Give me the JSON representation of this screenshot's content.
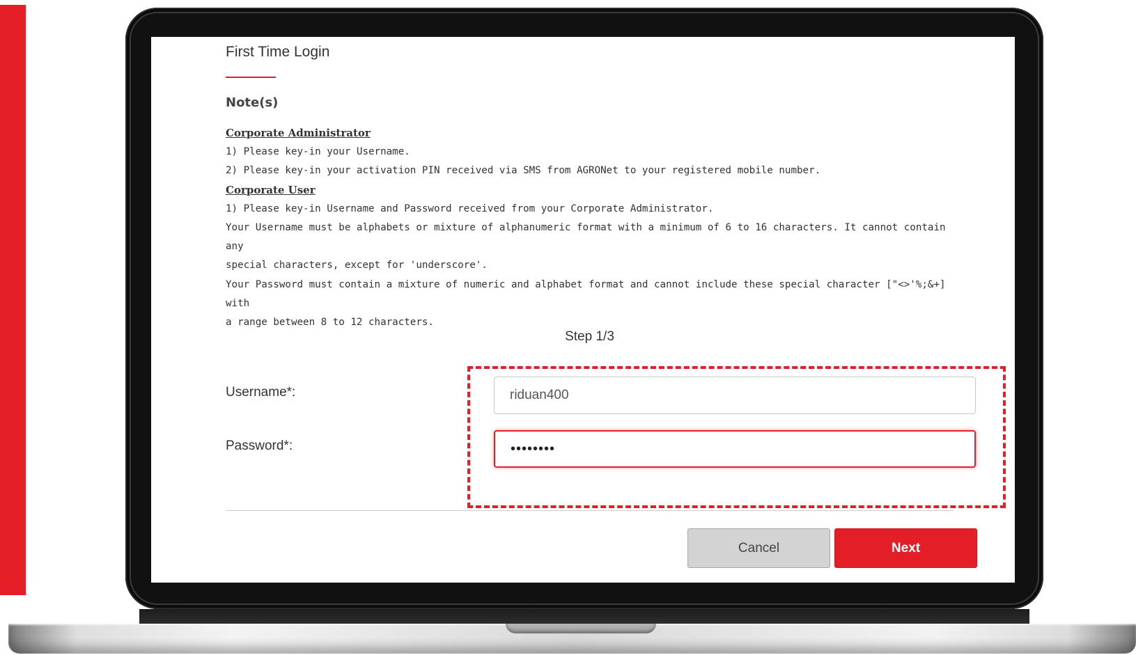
{
  "title": "First Time Login",
  "notes": {
    "heading": "Note(s)",
    "admin_title": "Corporate Administrator",
    "admin_line1": "1) Please key-in your Username.",
    "admin_line2": "2) Please key-in your activation PIN received via SMS from AGRONet to your registered mobile number.",
    "user_title": "Corporate User",
    "user_line1": "1) Please key-in Username and Password received from your Corporate Administrator.",
    "username_rule_a": "Your Username must be alphabets or mixture of alphanumeric format with a minimum of 6 to 16 characters. It cannot contain any",
    "username_rule_b": "special characters, except for 'underscore'.",
    "password_rule_a": "Your Password must contain a mixture of numeric and alphabet format and cannot include these special character [\"<>'%;&+] with",
    "password_rule_b": "a range between 8 to 12 characters."
  },
  "step": "Step 1/3",
  "form": {
    "username_label": "Username*:",
    "username_value": "riduan400",
    "password_label": "Password*:",
    "password_value": "••••••••"
  },
  "buttons": {
    "cancel": "Cancel",
    "next": "Next"
  },
  "colors": {
    "accent": "#e41e26",
    "cancel_bg": "#d3d3d3"
  }
}
